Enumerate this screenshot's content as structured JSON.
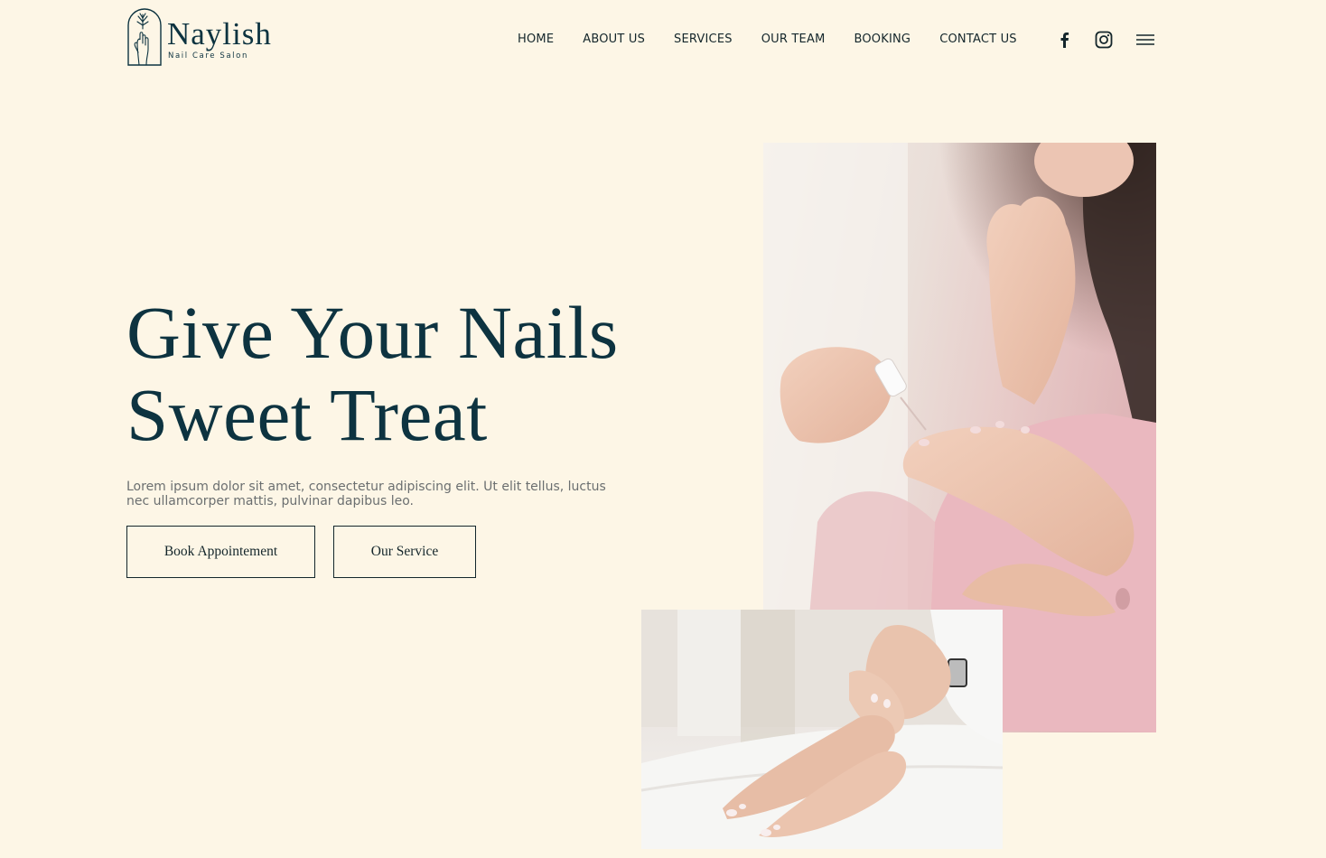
{
  "brand": {
    "name": "Naylish",
    "tagline": "Nail Care Salon"
  },
  "nav": {
    "items": [
      {
        "label": "HOME"
      },
      {
        "label": "ABOUT US"
      },
      {
        "label": "SERVICES"
      },
      {
        "label": "OUR TEAM"
      },
      {
        "label": "BOOKING"
      },
      {
        "label": "CONTACT US"
      }
    ]
  },
  "icons": {
    "facebook": "facebook-icon",
    "instagram": "instagram-icon",
    "menu": "menu-icon"
  },
  "hero": {
    "title_line1": "Give Your Nails",
    "title_line2": "Sweet Treat",
    "description": "Lorem ipsum dolor sit amet, consectetur adipiscing elit. Ut elit tellus, luctus nec ullamcorper mattis, pulvinar dapibus leo.",
    "primary_button": "Book Appointement",
    "secondary_button": "Our Service"
  },
  "colors": {
    "background": "#fdf6e6",
    "brand_dark": "#0d3340",
    "text_muted": "#6b6f70",
    "button_border": "#14262b"
  }
}
